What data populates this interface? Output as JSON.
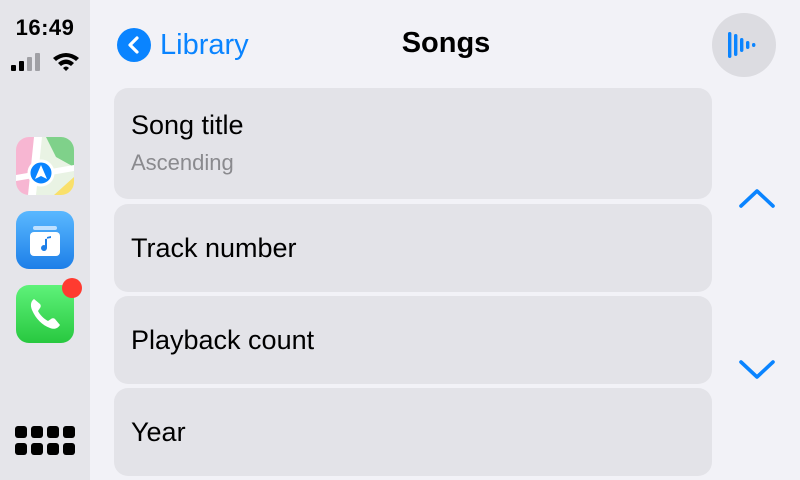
{
  "status": {
    "time": "16:49"
  },
  "dock": {
    "apps": [
      {
        "name": "Maps",
        "icon": "maps-icon"
      },
      {
        "name": "Music",
        "icon": "music-icon"
      },
      {
        "name": "Phone",
        "icon": "phone-icon",
        "badge": true
      }
    ],
    "grid_icon": "app-grid-icon"
  },
  "header": {
    "back_label": "Library",
    "title": "Songs",
    "now_playing_icon": "now-playing-waveform-icon"
  },
  "sort_options": [
    {
      "label": "Song title",
      "sublabel": "Ascending",
      "selected": true
    },
    {
      "label": "Track number",
      "sublabel": ""
    },
    {
      "label": "Playback count",
      "sublabel": ""
    },
    {
      "label": "Year",
      "sublabel": ""
    }
  ],
  "colors": {
    "accent": "#0a84ff",
    "badge": "#ff3b30",
    "sidebar_bg": "#e5e5ea",
    "row_bg": "#e3e3e8"
  }
}
